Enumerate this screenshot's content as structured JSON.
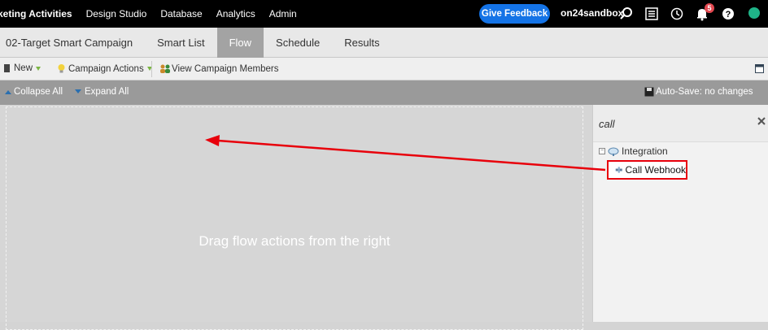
{
  "topbar": {
    "nav": [
      "keting Activities",
      "Design Studio",
      "Database",
      "Analytics",
      "Admin"
    ],
    "feedback_label": "Give Feedback",
    "account": "on24sandbox",
    "notification_count": "5",
    "icons": [
      "search-icon",
      "list-icon",
      "clock-icon",
      "bell-icon",
      "help-icon",
      "avatar"
    ]
  },
  "tabs": [
    {
      "label": "02-Target Smart Campaign"
    },
    {
      "label": "Smart List"
    },
    {
      "label": "Flow"
    },
    {
      "label": "Schedule"
    },
    {
      "label": "Results"
    }
  ],
  "toolbar": {
    "new_label": "New",
    "campaign_actions_label": "Campaign Actions",
    "view_members_label": "View Campaign Members"
  },
  "subbar": {
    "collapse_label": "Collapse All",
    "expand_label": "Expand All",
    "autosave_label": "Auto-Save: no changes"
  },
  "canvas": {
    "placeholder": "Drag flow actions from the right"
  },
  "panel": {
    "search_value": "call",
    "category": "Integration",
    "action": "Call Webhook"
  },
  "colors": {
    "accent": "#1473e6",
    "highlight": "#e8000b",
    "active_tab": "#a3a3a3"
  }
}
